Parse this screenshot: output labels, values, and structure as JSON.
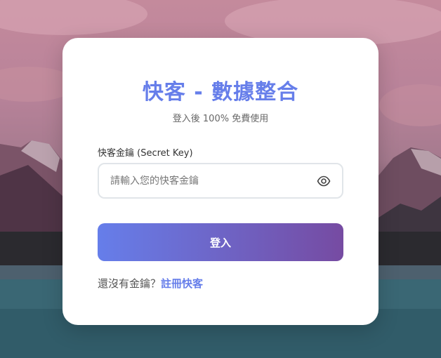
{
  "colors": {
    "accent": "#667eea",
    "accent_end": "#764ba2",
    "card_bg": "#ffffff"
  },
  "header": {
    "title": "快客 - 數據整合",
    "subtitle": "登入後 100% 免費使用"
  },
  "form": {
    "key_label": "快客金鑰 (Secret Key)",
    "key_placeholder": "請輸入您的快客金鑰",
    "key_value": "",
    "toggle_icon": "eye-icon",
    "submit_label": "登入"
  },
  "footer": {
    "prompt": "還沒有金鑰？",
    "register_link": "註冊快客"
  }
}
